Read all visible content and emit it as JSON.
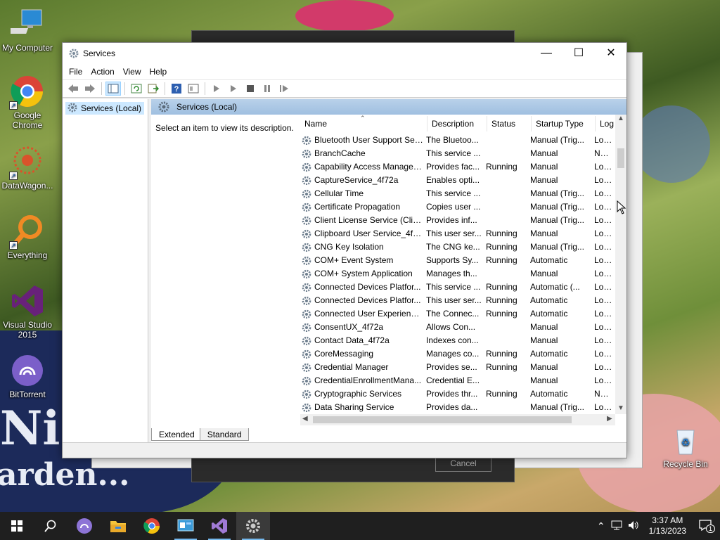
{
  "desktop": {
    "icons": [
      {
        "label": "My Computer",
        "icon": "computer-icon"
      },
      {
        "label": "Google Chrome",
        "icon": "chrome-icon"
      },
      {
        "label": "DataWagon...",
        "icon": "datawagon-icon"
      },
      {
        "label": "Everything",
        "icon": "everything-search-icon"
      },
      {
        "label": "Visual Studio 2015",
        "icon": "visual-studio-icon"
      },
      {
        "label": "BitTorrent",
        "icon": "bittorrent-icon"
      },
      {
        "label": "Recycle Bin",
        "icon": "recycle-bin-icon"
      }
    ],
    "wallpaper_text": [
      "Nig",
      "arden..."
    ]
  },
  "background_dialog": {
    "cancel_label": "Cancel"
  },
  "window": {
    "title": "Services",
    "controls": {
      "minimize": "—",
      "maximize": "☐",
      "close": "✕"
    },
    "menu": [
      "File",
      "Action",
      "View",
      "Help"
    ],
    "tree": {
      "item": "Services (Local)"
    },
    "pane_header": "Services (Local)",
    "description_prompt": "Select an item to view its description.",
    "columns": [
      "Name",
      "Description",
      "Status",
      "Startup Type",
      "Log"
    ],
    "services": [
      {
        "name": "Bluetooth User Support Ser...",
        "desc": "The Bluetoo...",
        "status": "",
        "startup": "Manual (Trig...",
        "log": "Loca"
      },
      {
        "name": "BranchCache",
        "desc": "This service ...",
        "status": "",
        "startup": "Manual",
        "log": "Netw"
      },
      {
        "name": "Capability Access Manager ...",
        "desc": "Provides fac...",
        "status": "Running",
        "startup": "Manual",
        "log": "Loca"
      },
      {
        "name": "CaptureService_4f72a",
        "desc": "Enables opti...",
        "status": "",
        "startup": "Manual",
        "log": "Loca"
      },
      {
        "name": "Cellular Time",
        "desc": "This service ...",
        "status": "",
        "startup": "Manual (Trig...",
        "log": "Loca"
      },
      {
        "name": "Certificate Propagation",
        "desc": "Copies user ...",
        "status": "",
        "startup": "Manual (Trig...",
        "log": "Loca"
      },
      {
        "name": "Client License Service (ClipS...",
        "desc": "Provides inf...",
        "status": "",
        "startup": "Manual (Trig...",
        "log": "Loca"
      },
      {
        "name": "Clipboard User Service_4f72a",
        "desc": "This user ser...",
        "status": "Running",
        "startup": "Manual",
        "log": "Loca"
      },
      {
        "name": "CNG Key Isolation",
        "desc": "The CNG ke...",
        "status": "Running",
        "startup": "Manual (Trig...",
        "log": "Loca"
      },
      {
        "name": "COM+ Event System",
        "desc": "Supports Sy...",
        "status": "Running",
        "startup": "Automatic",
        "log": "Loca"
      },
      {
        "name": "COM+ System Application",
        "desc": "Manages th...",
        "status": "",
        "startup": "Manual",
        "log": "Loca"
      },
      {
        "name": "Connected Devices Platfor...",
        "desc": "This service ...",
        "status": "Running",
        "startup": "Automatic (...",
        "log": "Loca"
      },
      {
        "name": "Connected Devices Platfor...",
        "desc": "This user ser...",
        "status": "Running",
        "startup": "Automatic",
        "log": "Loca"
      },
      {
        "name": "Connected User Experience...",
        "desc": "The Connec...",
        "status": "Running",
        "startup": "Automatic",
        "log": "Loca"
      },
      {
        "name": "ConsentUX_4f72a",
        "desc": "Allows Con...",
        "status": "",
        "startup": "Manual",
        "log": "Loca"
      },
      {
        "name": "Contact Data_4f72a",
        "desc": "Indexes con...",
        "status": "",
        "startup": "Manual",
        "log": "Loca"
      },
      {
        "name": "CoreMessaging",
        "desc": "Manages co...",
        "status": "Running",
        "startup": "Automatic",
        "log": "Loca"
      },
      {
        "name": "Credential Manager",
        "desc": "Provides se...",
        "status": "Running",
        "startup": "Manual",
        "log": "Loca"
      },
      {
        "name": "CredentialEnrollmentMana...",
        "desc": "Credential E...",
        "status": "",
        "startup": "Manual",
        "log": "Loca"
      },
      {
        "name": "Cryptographic Services",
        "desc": "Provides thr...",
        "status": "Running",
        "startup": "Automatic",
        "log": "Netw"
      },
      {
        "name": "Data Sharing Service",
        "desc": "Provides da...",
        "status": "",
        "startup": "Manual (Trig...",
        "log": "Loca"
      }
    ],
    "tabs": [
      "Extended",
      "Standard"
    ]
  },
  "taskbar": {
    "apps": [
      "start-icon",
      "search-icon",
      "bittorrent-icon",
      "file-explorer-icon",
      "chrome-icon",
      "control-panel-icon",
      "visual-studio-icon",
      "services-icon"
    ],
    "time": "3:37 AM",
    "date": "1/13/2023",
    "notification_count": "1"
  },
  "colors": {
    "selection": "#cce8ff",
    "header_blue": "#9fbfe0",
    "taskbar": "#1f1f1f"
  }
}
